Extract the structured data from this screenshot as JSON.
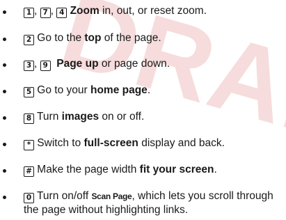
{
  "watermark": "DRAFT",
  "items": [
    {
      "keys": [
        "1",
        "7",
        "4"
      ],
      "key_sep": ", ",
      "bold": "Zoom",
      "text": " in, out, or reset zoom."
    },
    {
      "keys": [
        "2"
      ],
      "pre": " Go to the ",
      "bold": "top",
      "post": " of the page."
    },
    {
      "keys": [
        "3",
        "9"
      ],
      "key_sep": ", ",
      "bold": "Page up",
      "post": " or page down."
    },
    {
      "keys": [
        "5"
      ],
      "pre": " Go to your ",
      "bold": "home page",
      "post": "."
    },
    {
      "keys": [
        "8"
      ],
      "pre": " Turn ",
      "bold": "images",
      "post": " on or off."
    },
    {
      "keys": [
        "*"
      ],
      "pre": " Switch to ",
      "bold": "full-screen",
      "post": " display and back."
    },
    {
      "keys": [
        "#"
      ],
      "pre": " Make the page width ",
      "bold": "fit your screen",
      "post": "."
    },
    {
      "keys": [
        "0"
      ],
      "pre": " Turn on/off ",
      "bold": "Scan Page",
      "post": ", which lets you scroll through the page without highlighting links."
    }
  ]
}
